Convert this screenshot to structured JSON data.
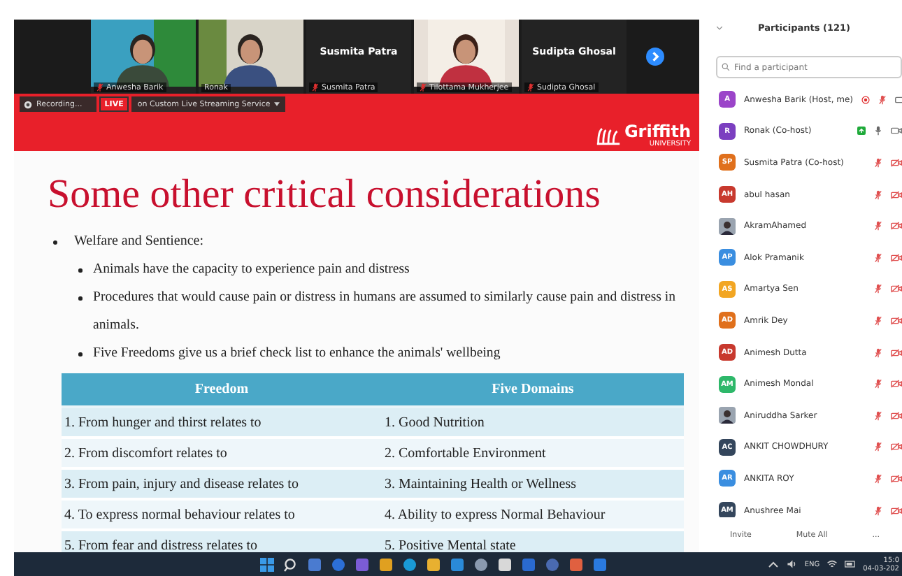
{
  "video_strip": {
    "tiles": [
      {
        "kind": "picture",
        "caption": "Anwesha Barik",
        "muted": true
      },
      {
        "kind": "picture",
        "caption": "Ronak",
        "muted": false
      },
      {
        "kind": "name",
        "display_name": "Susmita Patra",
        "caption": "Susmita Patra",
        "muted": true
      },
      {
        "kind": "picture",
        "caption": "Tilottama Mukherjee",
        "muted": true
      },
      {
        "kind": "name",
        "display_name": "Sudipta Ghosal",
        "caption": "Sudipta Ghosal",
        "muted": true
      }
    ]
  },
  "recording_bar": {
    "recording": "Recording...",
    "live": "LIVE",
    "service": "on Custom Live Streaming Service"
  },
  "slide": {
    "logo": {
      "name": "Griffith",
      "sub": "UNIVERSITY"
    },
    "title": "Some other critical considerations",
    "bullets": [
      {
        "text": "Welfare and Sentience:",
        "children": [
          {
            "text": "Animals have the capacity to experience pain and distress"
          },
          {
            "text": "Procedures that would cause pain or distress in humans are assumed to similarly cause pain and distress in animals."
          },
          {
            "text": "Five Freedoms give us a brief check list to enhance the animals' wellbeing"
          }
        ]
      }
    ],
    "table": {
      "columns": [
        "Freedom",
        "Five Domains"
      ],
      "rows": [
        [
          "1. From hunger and thirst relates to",
          "1. Good Nutrition"
        ],
        [
          "2. From discomfort relates to",
          "2. Comfortable Environment"
        ],
        [
          "3. From pain, injury and disease relates to",
          "3. Maintaining Health or Wellness"
        ],
        [
          "4. To express normal behaviour relates to",
          "4. Ability to express Normal Behaviour"
        ],
        [
          "5. From fear and distress relates to",
          "5. Positive Mental state"
        ]
      ]
    }
  },
  "participants": {
    "title": "Participants (121)",
    "search": {
      "placeholder": "Find a participant"
    },
    "items": [
      {
        "kind": "initials",
        "initials": "A",
        "name": "Anwesha Barik (Host, me)",
        "color": "#9b45c9",
        "recording": true,
        "sharing": false,
        "muted": true,
        "video_off": false
      },
      {
        "kind": "initials",
        "initials": "R",
        "name": "Ronak (Co-host)",
        "color": "#7b3fc0",
        "recording": false,
        "sharing": true,
        "muted": false,
        "video_off": false
      },
      {
        "kind": "initials",
        "initials": "SP",
        "name": "Susmita Patra (Co-host)",
        "color": "#e0701c",
        "recording": false,
        "sharing": false,
        "muted": true,
        "video_off": true
      },
      {
        "kind": "initials",
        "initials": "AH",
        "name": "abul hasan",
        "color": "#c8392e",
        "recording": false,
        "sharing": false,
        "muted": true,
        "video_off": true
      },
      {
        "kind": "picture",
        "name": "AkramAhamed",
        "recording": false,
        "sharing": false,
        "muted": true,
        "video_off": true
      },
      {
        "kind": "initials",
        "initials": "AP",
        "name": "Alok Pramanik",
        "color": "#3a8ee0",
        "recording": false,
        "sharing": false,
        "muted": true,
        "video_off": true
      },
      {
        "kind": "initials",
        "initials": "AS",
        "name": "Amartya Sen",
        "color": "#f2a623",
        "recording": false,
        "sharing": false,
        "muted": true,
        "video_off": true
      },
      {
        "kind": "initials",
        "initials": "AD",
        "name": "Amrik Dey",
        "color": "#e0701c",
        "recording": false,
        "sharing": false,
        "muted": true,
        "video_off": true
      },
      {
        "kind": "initials",
        "initials": "AD",
        "name": "Animesh Dutta",
        "color": "#c8392e",
        "recording": false,
        "sharing": false,
        "muted": true,
        "video_off": true
      },
      {
        "kind": "initials",
        "initials": "AM",
        "name": "Animesh Mondal",
        "color": "#2eb86a",
        "recording": false,
        "sharing": false,
        "muted": true,
        "video_off": true
      },
      {
        "kind": "picture",
        "name": "Aniruddha Sarker",
        "recording": false,
        "sharing": false,
        "muted": true,
        "video_off": true
      },
      {
        "kind": "initials",
        "initials": "AC",
        "name": "ANKIT CHOWDHURY",
        "color": "#34465c",
        "recording": false,
        "sharing": false,
        "muted": true,
        "video_off": true
      },
      {
        "kind": "initials",
        "initials": "AR",
        "name": "ANKITA ROY",
        "color": "#3a8ee0",
        "recording": false,
        "sharing": false,
        "muted": true,
        "video_off": true
      },
      {
        "kind": "initials",
        "initials": "AM",
        "name": "Anushree Mai",
        "color": "#34465c",
        "recording": false,
        "sharing": false,
        "muted": true,
        "video_off": true
      }
    ],
    "buttons": [
      "Invite",
      "Mute All",
      "..."
    ]
  },
  "taskbar": {
    "language": "ENG",
    "time": "15:0",
    "date": "04-03-202"
  }
}
